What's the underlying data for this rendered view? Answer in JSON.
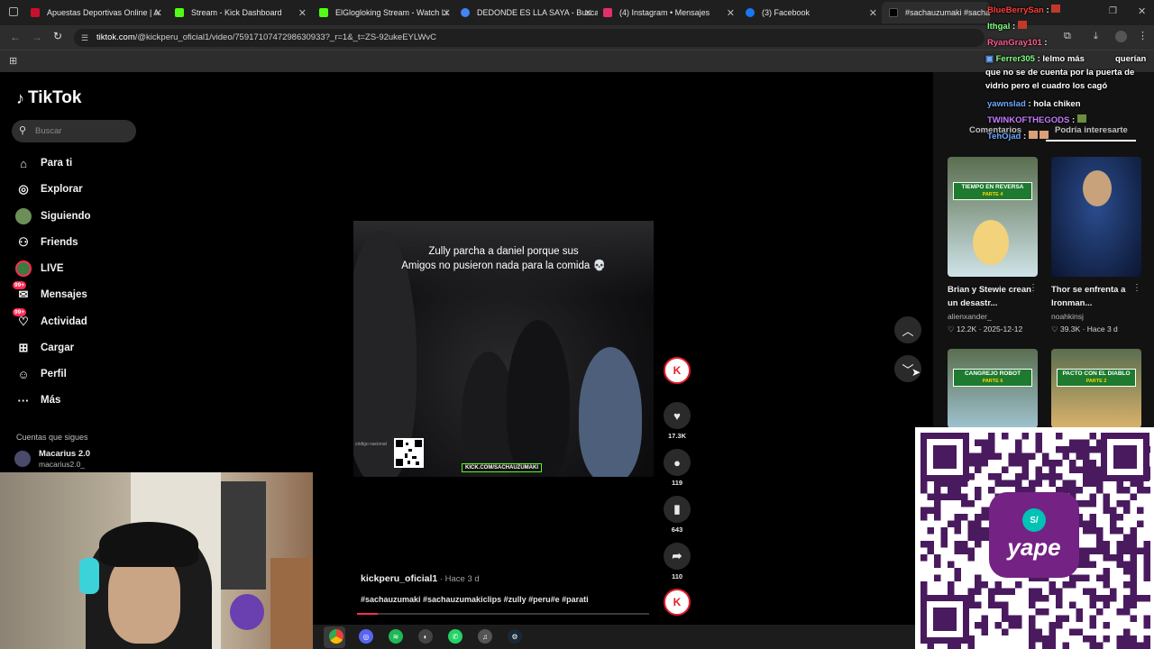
{
  "browser": {
    "tabs": [
      {
        "label": "Apuestas Deportivas Online | A",
        "fav_color": "#c8102e"
      },
      {
        "label": "Stream - Kick Dashboard",
        "fav_color": "#53fc18"
      },
      {
        "label": "ElGlogloking Stream - Watch Li",
        "fav_color": "#53fc18"
      },
      {
        "label": "DEDONDE ES LLA SAYA - Busca",
        "fav_color": "#4285f4"
      },
      {
        "label": "(4) Instagram • Mensajes",
        "fav_color": "#e1306c"
      },
      {
        "label": "(3) Facebook",
        "fav_color": "#1877f2"
      },
      {
        "label": "#sachauzumaki #sachauzu",
        "fav_color": "#000000"
      }
    ],
    "url_domain": "tiktok.com",
    "url_path": "/@kickperu_oficial1/video/7591710747298630933?_r=1&_t=ZS-92ukeEYLWvC"
  },
  "sidebar": {
    "logo": "TikTok",
    "search_placeholder": "Buscar",
    "items": [
      {
        "label": "Para ti",
        "icon": "home-icon"
      },
      {
        "label": "Explorar",
        "icon": "compass-icon"
      },
      {
        "label": "Siguiendo",
        "icon": "avatar-icon"
      },
      {
        "label": "Friends",
        "icon": "friends-icon"
      },
      {
        "label": "LIVE",
        "icon": "live-icon"
      },
      {
        "label": "Mensajes",
        "icon": "message-icon",
        "badge": "99+"
      },
      {
        "label": "Actividad",
        "icon": "activity-icon",
        "badge": "99+"
      },
      {
        "label": "Cargar",
        "icon": "upload-icon"
      },
      {
        "label": "Perfil",
        "icon": "profile-icon"
      },
      {
        "label": "Más",
        "icon": "more-icon"
      }
    ],
    "following_heading": "Cuentas que sigues",
    "following": [
      {
        "name": "Macarius 2.0",
        "handle": "macarius2.0_"
      }
    ]
  },
  "video": {
    "caption_line1": "Zully parcha a daniel porque sus",
    "caption_line2": "Amigos no pusieron nada para la comida 💀",
    "kick_label": "KICK.COM/SACHAUZUMAKI",
    "codigo": "código nacional",
    "author": "kickperu_oficial1",
    "age": " · Hace 3 d",
    "hashtags": "#sachauzumaki #sachauzumakiclips #zully #peru#e #parati",
    "progress": 0.07,
    "actions": {
      "likes": "17.3K",
      "comments": "119",
      "saves": "643",
      "shares": "110"
    }
  },
  "right_panel": {
    "tabs": [
      "Comentarios",
      "Podría interesarte"
    ],
    "videos": [
      {
        "title": "Brian y Stewie crean un desastr...",
        "author": "alienxander_",
        "likes": "12.2K",
        "date": "2025-12-12",
        "thumb_label": "TIEMPO EN REVERSA",
        "thumb_part": "PARTE 4"
      },
      {
        "title": "Thor se enfrenta a Ironman...",
        "author": "noahkinsj",
        "likes": "39.3K",
        "date": "Hace 3 d",
        "thumb_label": "",
        "thumb_part": ""
      },
      {
        "title": "",
        "author": "",
        "likes": "",
        "date": "",
        "thumb_label": "CANGREJO ROBOT",
        "thumb_part": "PARTE 6"
      },
      {
        "title": "",
        "author": "",
        "likes": "",
        "date": "",
        "thumb_label": "PACTO CON EL DIABLO",
        "thumb_part": "PARTE 2"
      }
    ]
  },
  "chat": [
    {
      "user": "BlueBerrySan",
      "msg": "",
      "color": "#ff3b3b"
    },
    {
      "user": "Ithgal",
      "msg": "",
      "color": "#7fff7f"
    },
    {
      "user": "RyanGray101",
      "msg": "",
      "color": "#ff5b8c"
    },
    {
      "user": "Ferrer305",
      "msg": "lelmo más",
      "color": "#7fff7f"
    },
    {
      "user": "",
      "msg": "querían que no se de cuenta por la puerta de vidrio pero el cuadro los cagó",
      "color": "#ffffff"
    },
    {
      "user": "yawnslad",
      "msg": "hola chiken",
      "color": "#6fa8ff"
    },
    {
      "user": "TWINKOFTHEGODS",
      "msg": "",
      "color": "#c77dff"
    },
    {
      "user": "TehOjad",
      "msg": "",
      "color": "#6fa8ff"
    }
  ],
  "yape_label": "yape",
  "yape_symbol": "S/",
  "colors": {
    "accent": "#fe2c55",
    "kick": "#53fc18",
    "yape": "#742284"
  }
}
